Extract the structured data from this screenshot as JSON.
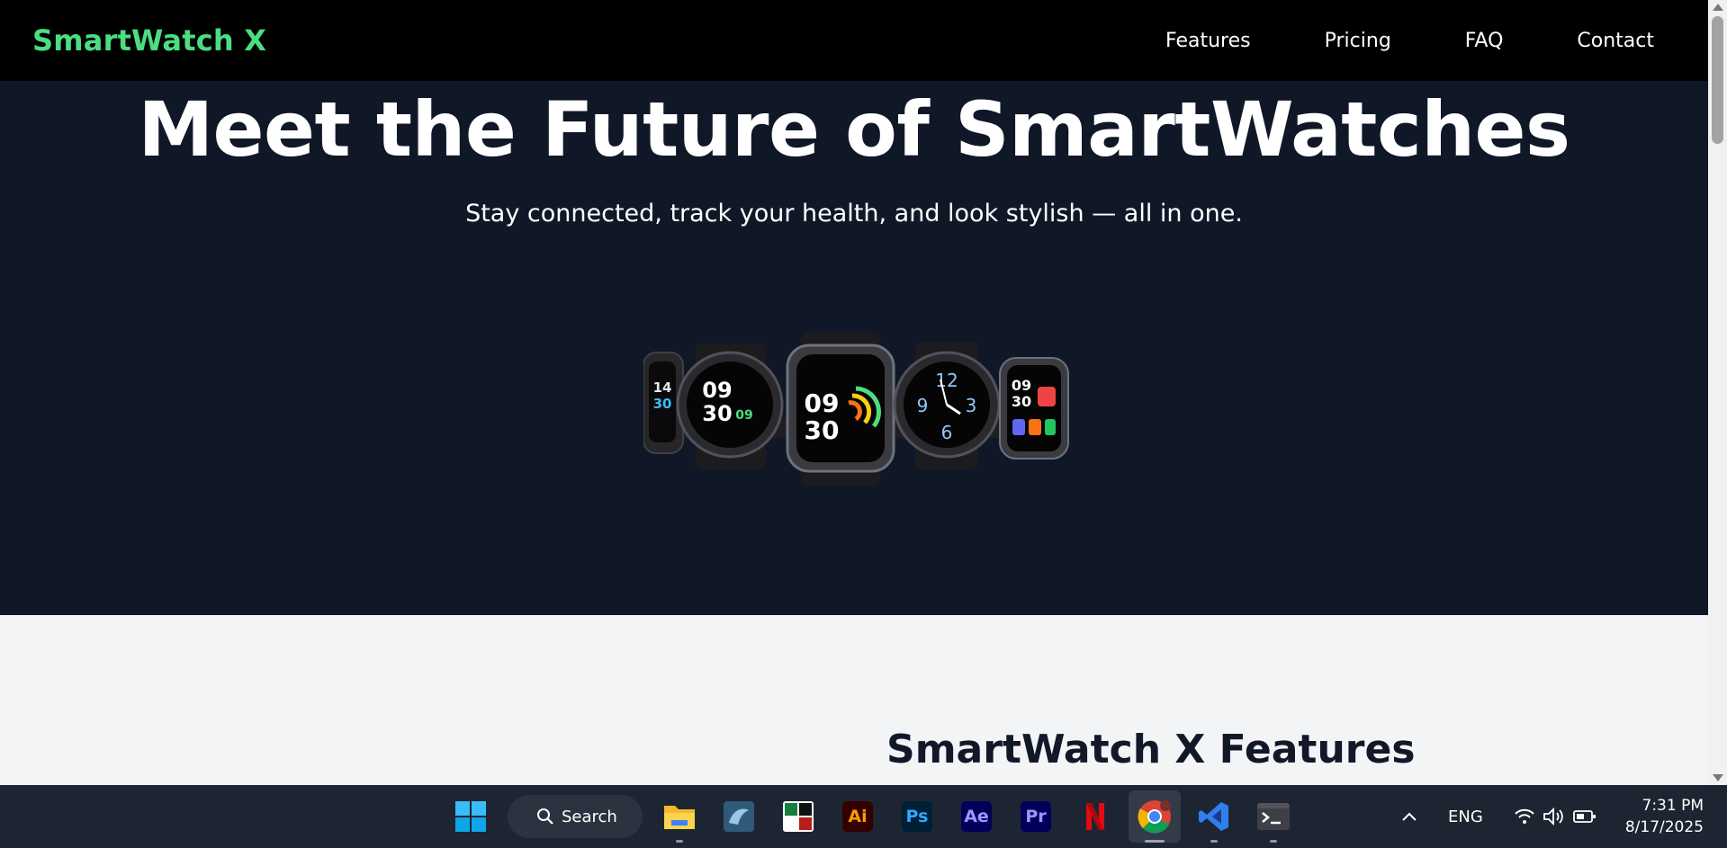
{
  "nav": {
    "brand": "SmartWatch X",
    "links": [
      "Features",
      "Pricing",
      "FAQ",
      "Contact"
    ]
  },
  "hero": {
    "title": "Meet the Future of SmartWatches",
    "subtitle": "Stay connected, track your health, and look stylish — all in one."
  },
  "features": {
    "title": "SmartWatch X Features"
  },
  "colors": {
    "brand_green": "#4ade80",
    "hero_bg": "#101828",
    "nav_bg": "#000000",
    "section_bg": "#f3f4f6"
  },
  "taskbar": {
    "search_label": "Search",
    "apps": [
      "windows-start",
      "file-explorer",
      "mysql-workbench",
      "grading-app",
      "illustrator",
      "photoshop",
      "after-effects",
      "premiere-pro",
      "netflix",
      "chrome",
      "vscode",
      "terminal"
    ],
    "app_labels": {
      "illustrator": "Ai",
      "photoshop": "Ps",
      "after_effects": "Ae",
      "premiere": "Pr"
    },
    "tray": {
      "language": "ENG",
      "time": "7:31 PM",
      "date": "8/17/2025"
    }
  }
}
